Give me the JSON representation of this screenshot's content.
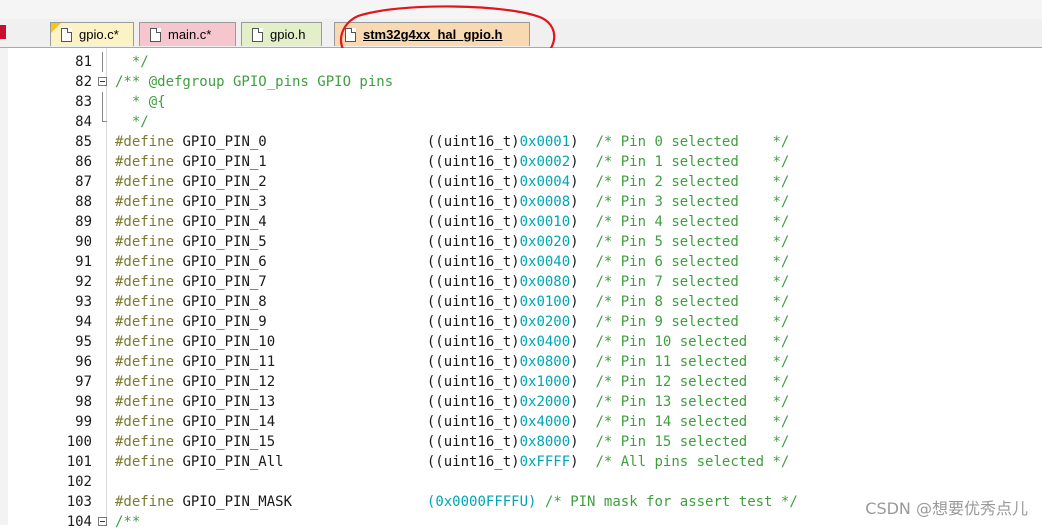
{
  "tabs": [
    {
      "name": "tab-gpio-c",
      "label": "gpio.c*",
      "bg": "#fbf2c6"
    },
    {
      "name": "tab-main-c",
      "label": "main.c*",
      "bg": "#f6c6cf"
    },
    {
      "name": "tab-gpio-h",
      "label": "gpio.h",
      "bg": "#e3efc8"
    },
    {
      "name": "tab-stm32g4xx-hal-gpio-h",
      "label": "stm32g4xx_hal_gpio.h",
      "bg": "#f8d9b2"
    }
  ],
  "lines": [
    {
      "num": "81",
      "fold": "line",
      "tokens": [
        {
          "t": "  */",
          "c": "c"
        }
      ]
    },
    {
      "num": "82",
      "fold": "box",
      "tokens": [
        {
          "t": "/** @defgroup GPIO_pins GPIO pins",
          "c": "c"
        }
      ]
    },
    {
      "num": "83",
      "fold": "line",
      "tokens": [
        {
          "t": "  * @{",
          "c": "c"
        }
      ]
    },
    {
      "num": "84",
      "fold": "end",
      "tokens": [
        {
          "t": "  */",
          "c": "c"
        }
      ]
    },
    {
      "num": "85",
      "tokens": [
        {
          "t": "#define",
          "c": "d"
        },
        {
          "t": " GPIO_PIN_0                   ((uint16_t)",
          "c": "n"
        },
        {
          "t": "0x0001",
          "c": "hx"
        },
        {
          "t": ")  ",
          "c": "n"
        },
        {
          "t": "/* Pin 0 selected    */",
          "c": "c"
        }
      ]
    },
    {
      "num": "86",
      "tokens": [
        {
          "t": "#define",
          "c": "d"
        },
        {
          "t": " GPIO_PIN_1                   ((uint16_t)",
          "c": "n"
        },
        {
          "t": "0x0002",
          "c": "hx"
        },
        {
          "t": ")  ",
          "c": "n"
        },
        {
          "t": "/* Pin 1 selected    */",
          "c": "c"
        }
      ]
    },
    {
      "num": "87",
      "tokens": [
        {
          "t": "#define",
          "c": "d"
        },
        {
          "t": " GPIO_PIN_2                   ((uint16_t)",
          "c": "n"
        },
        {
          "t": "0x0004",
          "c": "hx"
        },
        {
          "t": ")  ",
          "c": "n"
        },
        {
          "t": "/* Pin 2 selected    */",
          "c": "c"
        }
      ]
    },
    {
      "num": "88",
      "tokens": [
        {
          "t": "#define",
          "c": "d"
        },
        {
          "t": " GPIO_PIN_3                   ((uint16_t)",
          "c": "n"
        },
        {
          "t": "0x0008",
          "c": "hx"
        },
        {
          "t": ")  ",
          "c": "n"
        },
        {
          "t": "/* Pin 3 selected    */",
          "c": "c"
        }
      ]
    },
    {
      "num": "89",
      "tokens": [
        {
          "t": "#define",
          "c": "d"
        },
        {
          "t": " GPIO_PIN_4                   ((uint16_t)",
          "c": "n"
        },
        {
          "t": "0x0010",
          "c": "hx"
        },
        {
          "t": ")  ",
          "c": "n"
        },
        {
          "t": "/* Pin 4 selected    */",
          "c": "c"
        }
      ]
    },
    {
      "num": "90",
      "tokens": [
        {
          "t": "#define",
          "c": "d"
        },
        {
          "t": " GPIO_PIN_5                   ((uint16_t)",
          "c": "n"
        },
        {
          "t": "0x0020",
          "c": "hx"
        },
        {
          "t": ")  ",
          "c": "n"
        },
        {
          "t": "/* Pin 5 selected    */",
          "c": "c"
        }
      ]
    },
    {
      "num": "91",
      "tokens": [
        {
          "t": "#define",
          "c": "d"
        },
        {
          "t": " GPIO_PIN_6                   ((uint16_t)",
          "c": "n"
        },
        {
          "t": "0x0040",
          "c": "hx"
        },
        {
          "t": ")  ",
          "c": "n"
        },
        {
          "t": "/* Pin 6 selected    */",
          "c": "c"
        }
      ]
    },
    {
      "num": "92",
      "tokens": [
        {
          "t": "#define",
          "c": "d"
        },
        {
          "t": " GPIO_PIN_7                   ((uint16_t)",
          "c": "n"
        },
        {
          "t": "0x0080",
          "c": "hx"
        },
        {
          "t": ")  ",
          "c": "n"
        },
        {
          "t": "/* Pin 7 selected    */",
          "c": "c"
        }
      ]
    },
    {
      "num": "93",
      "tokens": [
        {
          "t": "#define",
          "c": "d"
        },
        {
          "t": " GPIO_PIN_8                   ((uint16_t)",
          "c": "n"
        },
        {
          "t": "0x0100",
          "c": "hx"
        },
        {
          "t": ")  ",
          "c": "n"
        },
        {
          "t": "/* Pin 8 selected    */",
          "c": "c"
        }
      ]
    },
    {
      "num": "94",
      "tokens": [
        {
          "t": "#define",
          "c": "d"
        },
        {
          "t": " GPIO_PIN_9                   ((uint16_t)",
          "c": "n"
        },
        {
          "t": "0x0200",
          "c": "hx"
        },
        {
          "t": ")  ",
          "c": "n"
        },
        {
          "t": "/* Pin 9 selected    */",
          "c": "c"
        }
      ]
    },
    {
      "num": "95",
      "tokens": [
        {
          "t": "#define",
          "c": "d"
        },
        {
          "t": " GPIO_PIN_10                  ((uint16_t)",
          "c": "n"
        },
        {
          "t": "0x0400",
          "c": "hx"
        },
        {
          "t": ")  ",
          "c": "n"
        },
        {
          "t": "/* Pin 10 selected   */",
          "c": "c"
        }
      ]
    },
    {
      "num": "96",
      "tokens": [
        {
          "t": "#define",
          "c": "d"
        },
        {
          "t": " GPIO_PIN_11                  ((uint16_t)",
          "c": "n"
        },
        {
          "t": "0x0800",
          "c": "hx"
        },
        {
          "t": ")  ",
          "c": "n"
        },
        {
          "t": "/* Pin 11 selected   */",
          "c": "c"
        }
      ]
    },
    {
      "num": "97",
      "tokens": [
        {
          "t": "#define",
          "c": "d"
        },
        {
          "t": " GPIO_PIN_12                  ((uint16_t)",
          "c": "n"
        },
        {
          "t": "0x1000",
          "c": "hx"
        },
        {
          "t": ")  ",
          "c": "n"
        },
        {
          "t": "/* Pin 12 selected   */",
          "c": "c"
        }
      ]
    },
    {
      "num": "98",
      "tokens": [
        {
          "t": "#define",
          "c": "d"
        },
        {
          "t": " GPIO_PIN_13                  ((uint16_t)",
          "c": "n"
        },
        {
          "t": "0x2000",
          "c": "hx"
        },
        {
          "t": ")  ",
          "c": "n"
        },
        {
          "t": "/* Pin 13 selected   */",
          "c": "c"
        }
      ]
    },
    {
      "num": "99",
      "tokens": [
        {
          "t": "#define",
          "c": "d"
        },
        {
          "t": " GPIO_PIN_14                  ((uint16_t)",
          "c": "n"
        },
        {
          "t": "0x4000",
          "c": "hx"
        },
        {
          "t": ")  ",
          "c": "n"
        },
        {
          "t": "/* Pin 14 selected   */",
          "c": "c"
        }
      ]
    },
    {
      "num": "100",
      "tokens": [
        {
          "t": "#define",
          "c": "d"
        },
        {
          "t": " GPIO_PIN_15                  ((uint16_t)",
          "c": "n"
        },
        {
          "t": "0x8000",
          "c": "hx"
        },
        {
          "t": ")  ",
          "c": "n"
        },
        {
          "t": "/* Pin 15 selected   */",
          "c": "c"
        }
      ]
    },
    {
      "num": "101",
      "tokens": [
        {
          "t": "#define",
          "c": "d"
        },
        {
          "t": " GPIO_PIN_All                 ((uint16_t)",
          "c": "n"
        },
        {
          "t": "0xFFFF",
          "c": "hx"
        },
        {
          "t": ")  ",
          "c": "n"
        },
        {
          "t": "/* All pins selected */",
          "c": "c"
        }
      ]
    },
    {
      "num": "102",
      "tokens": []
    },
    {
      "num": "103",
      "tokens": [
        {
          "t": "#define",
          "c": "d"
        },
        {
          "t": " GPIO_PIN_MASK                ",
          "c": "n"
        },
        {
          "t": "(0x0000FFFFU)",
          "c": "hx"
        },
        {
          "t": " ",
          "c": "n"
        },
        {
          "t": "/* PIN mask for assert test */",
          "c": "c"
        }
      ]
    },
    {
      "num": "104",
      "fold": "box",
      "tokens": [
        {
          "t": "/**",
          "c": "c"
        }
      ]
    }
  ],
  "watermark": "CSDN @想要优秀点儿"
}
